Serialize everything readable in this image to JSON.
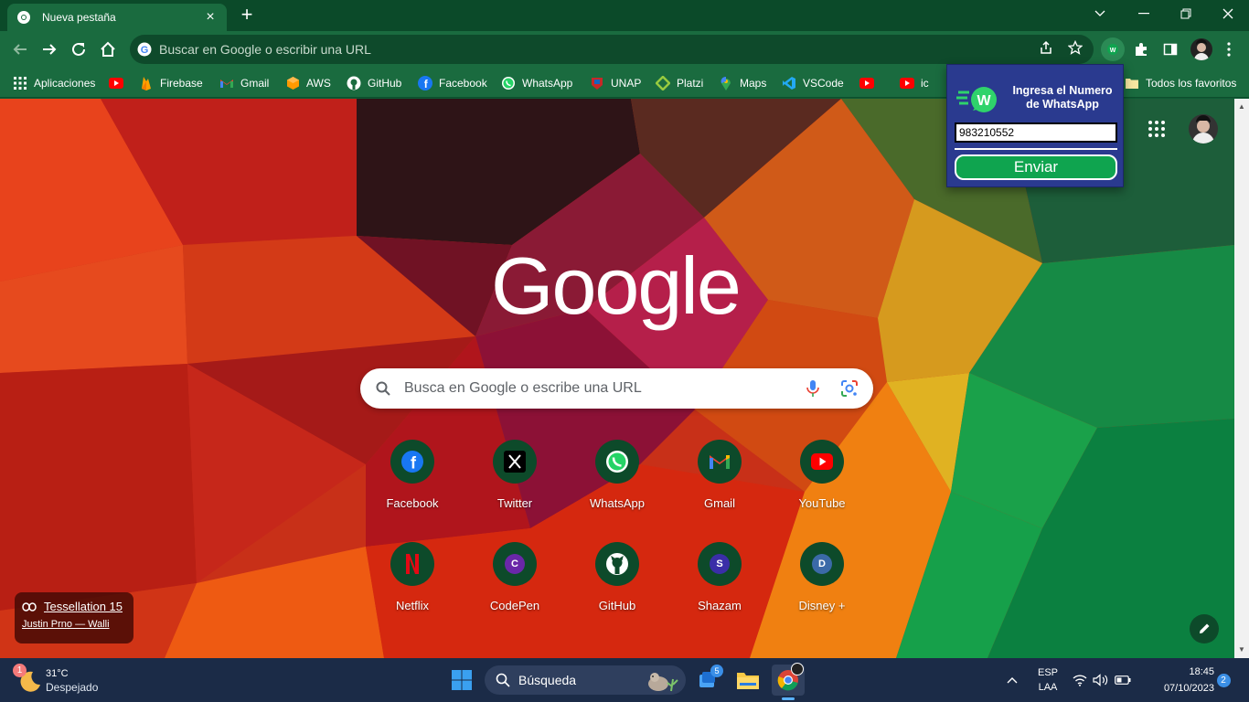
{
  "browser": {
    "tab": {
      "title": "Nueva pestaña"
    },
    "omnibox": {
      "placeholder": "Buscar en Google o escribir una URL"
    }
  },
  "bookmarks": [
    {
      "label": "Aplicaciones",
      "icon": "apps-grid-icon"
    },
    {
      "label": "",
      "icon": "youtube-icon"
    },
    {
      "label": "Firebase",
      "icon": "firebase-icon"
    },
    {
      "label": "Gmail",
      "icon": "gmail-icon"
    },
    {
      "label": "AWS",
      "icon": "aws-icon"
    },
    {
      "label": "GitHub",
      "icon": "github-icon"
    },
    {
      "label": "Facebook",
      "icon": "facebook-icon"
    },
    {
      "label": "WhatsApp",
      "icon": "whatsapp-icon"
    },
    {
      "label": "UNAP",
      "icon": "unap-icon"
    },
    {
      "label": "Platzi",
      "icon": "platzi-icon"
    },
    {
      "label": "Maps",
      "icon": "maps-icon"
    },
    {
      "label": "VSCode",
      "icon": "vscode-icon"
    },
    {
      "label": "",
      "icon": "youtube-icon"
    },
    {
      "label": "ic",
      "icon": "youtube-icon"
    },
    {
      "label": "Todos los favoritos",
      "icon": "folder-icon"
    }
  ],
  "ntp": {
    "logo": "Google",
    "search_placeholder": "Busca en Google o escribe una URL",
    "shortcuts": [
      {
        "label": "Facebook",
        "icon": "facebook-icon"
      },
      {
        "label": "Twitter",
        "icon": "x-icon"
      },
      {
        "label": "WhatsApp",
        "icon": "whatsapp-icon"
      },
      {
        "label": "Gmail",
        "icon": "gmail-icon"
      },
      {
        "label": "YouTube",
        "icon": "youtube-icon"
      },
      {
        "label": "Netflix",
        "icon": "netflix-icon"
      },
      {
        "label": "CodePen",
        "icon": "letter-c-icon",
        "letter": "C"
      },
      {
        "label": "GitHub",
        "icon": "github-icon"
      },
      {
        "label": "Shazam",
        "icon": "letter-s-icon",
        "letter": "S"
      },
      {
        "label": "Disney +",
        "icon": "letter-d-icon",
        "letter": "D"
      }
    ],
    "attribution": {
      "title": "Tessellation 15",
      "author": "Justin Prno — Walli"
    }
  },
  "popup": {
    "title": "Ingresa el Numero de WhatsApp",
    "phone_value": "983210552",
    "button_label": "Enviar",
    "logo_letter": "W"
  },
  "taskbar": {
    "weather": {
      "temp": "31°C",
      "condition": "Despejado",
      "badge": "1"
    },
    "search_label": "Búsqueda",
    "widgets_badge": "5",
    "lang_top": "ESP",
    "lang_bottom": "LAA",
    "time": "18:45",
    "date": "07/10/2023",
    "notification_count": "2"
  },
  "colors": {
    "chrome_frame": "#0b4a29",
    "chrome_toolbar": "#1a6b3f",
    "popup_bg": "#2a3a8f",
    "popup_button": "#0fa44f",
    "taskbar": "#1b2b47"
  }
}
